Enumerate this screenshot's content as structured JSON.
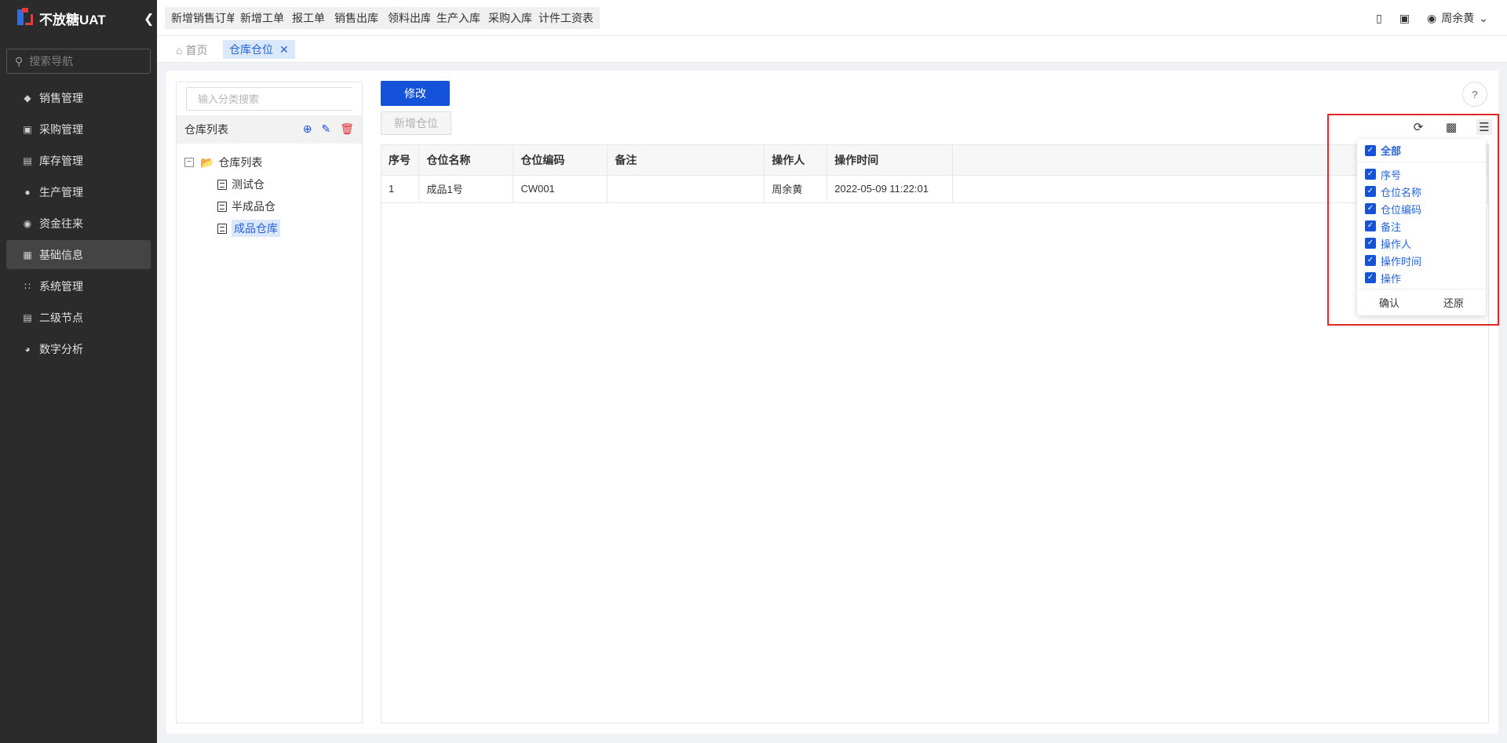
{
  "app": {
    "title": "不放糖UAT",
    "collapse_icon": "chevron-left-icon"
  },
  "nav": {
    "search_placeholder": "搜索导航",
    "items": [
      {
        "label": "销售管理",
        "icon": "tag-icon",
        "active": false
      },
      {
        "label": "采购管理",
        "icon": "cart-icon",
        "active": false
      },
      {
        "label": "库存管理",
        "icon": "box-icon",
        "active": false
      },
      {
        "label": "生产管理",
        "icon": "production-icon",
        "active": false
      },
      {
        "label": "资金往来",
        "icon": "money-icon",
        "active": false
      },
      {
        "label": "基础信息",
        "icon": "grid-icon",
        "active": true
      },
      {
        "label": "系统管理",
        "icon": "apps-icon",
        "active": false
      },
      {
        "label": "二级节点",
        "icon": "doc-icon",
        "active": false
      },
      {
        "label": "数字分析",
        "icon": "pie-icon",
        "active": false
      }
    ]
  },
  "quick_actions": [
    "新增销售订单",
    "新增工单",
    "报工单",
    "销售出库",
    "领料出库",
    "生产入库",
    "采购入库",
    "计件工资表"
  ],
  "header": {
    "user_name": "周余黄"
  },
  "tabs": {
    "home": "首页",
    "active": "仓库仓位"
  },
  "tree": {
    "search_placeholder": "输入分类搜索",
    "title": "仓库列表",
    "root": "仓库列表",
    "children": [
      {
        "label": "测试仓",
        "selected": false
      },
      {
        "label": "半成品仓",
        "selected": false
      },
      {
        "label": "成品仓库",
        "selected": true
      }
    ]
  },
  "toolbar": {
    "edit_label": "修改",
    "add_label": "新增仓位"
  },
  "table": {
    "columns": [
      "序号",
      "仓位名称",
      "仓位编码",
      "备注",
      "操作人",
      "操作时间"
    ],
    "rows": [
      [
        "1",
        "成品1号",
        "CW001",
        "",
        "周余黄",
        "2022-05-09 11:22:01"
      ]
    ]
  },
  "column_picker": {
    "all_label": "全部",
    "options": [
      "序号",
      "仓位名称",
      "仓位编码",
      "备注",
      "操作人",
      "操作时间",
      "操作"
    ],
    "confirm_label": "确认",
    "reset_label": "还原"
  },
  "colors": {
    "primary": "#1352d9",
    "sidebar_bg": "#2b2b2b",
    "highlight": "#e0282a",
    "active_tab_bg": "#dbe7fb"
  }
}
